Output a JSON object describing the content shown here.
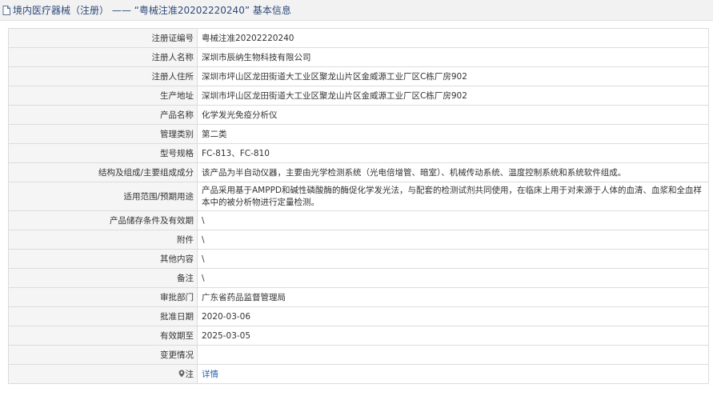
{
  "header": {
    "title": "境内医疗器械（注册） —— “粤械注准20202220240” 基本信息"
  },
  "rows": [
    {
      "label": "注册证编号",
      "value": "粤械注准20202220240"
    },
    {
      "label": "注册人名称",
      "value": "深圳市辰纳生物科技有限公司"
    },
    {
      "label": "注册人住所",
      "value": "深圳市坪山区龙田街道大工业区聚龙山片区金威源工业厂区C栋厂房902"
    },
    {
      "label": "生产地址",
      "value": "深圳市坪山区龙田街道大工业区聚龙山片区金威源工业厂区C栋厂房902"
    },
    {
      "label": "产品名称",
      "value": "化学发光免疫分析仪"
    },
    {
      "label": "管理类别",
      "value": "第二类"
    },
    {
      "label": "型号规格",
      "value": "FC-813、FC-810"
    },
    {
      "label": "结构及组成/主要组成成分",
      "value": "该产品为半自动仪器，主要由光学检测系统（光电倍增管、暗室）、机械传动系统、温度控制系统和系统软件组成。"
    },
    {
      "label": "适用范围/预期用途",
      "value": "产品采用基于AMPPD和碱性磷酸酶的酶促化学发光法，与配套的检测试剂共同使用，在临床上用于对来源于人体的血清、血浆和全血样本中的被分析物进行定量检测。"
    },
    {
      "label": "产品储存条件及有效期",
      "value": "\\"
    },
    {
      "label": "附件",
      "value": "\\"
    },
    {
      "label": "其他内容",
      "value": "\\"
    },
    {
      "label": "备注",
      "value": "\\"
    },
    {
      "label": "审批部门",
      "value": "广东省药品监督管理局"
    },
    {
      "label": "批准日期",
      "value": "2020-03-06"
    },
    {
      "label": "有效期至",
      "value": "2025-03-05"
    },
    {
      "label": "变更情况",
      "value": ""
    }
  ],
  "note_row": {
    "label": "注",
    "link_text": "详情"
  },
  "colors": {
    "link": "#2a64b5",
    "label_bg": "#f5f5f5",
    "border": "#dcdcdc",
    "title_text": "#2f4a7a"
  }
}
